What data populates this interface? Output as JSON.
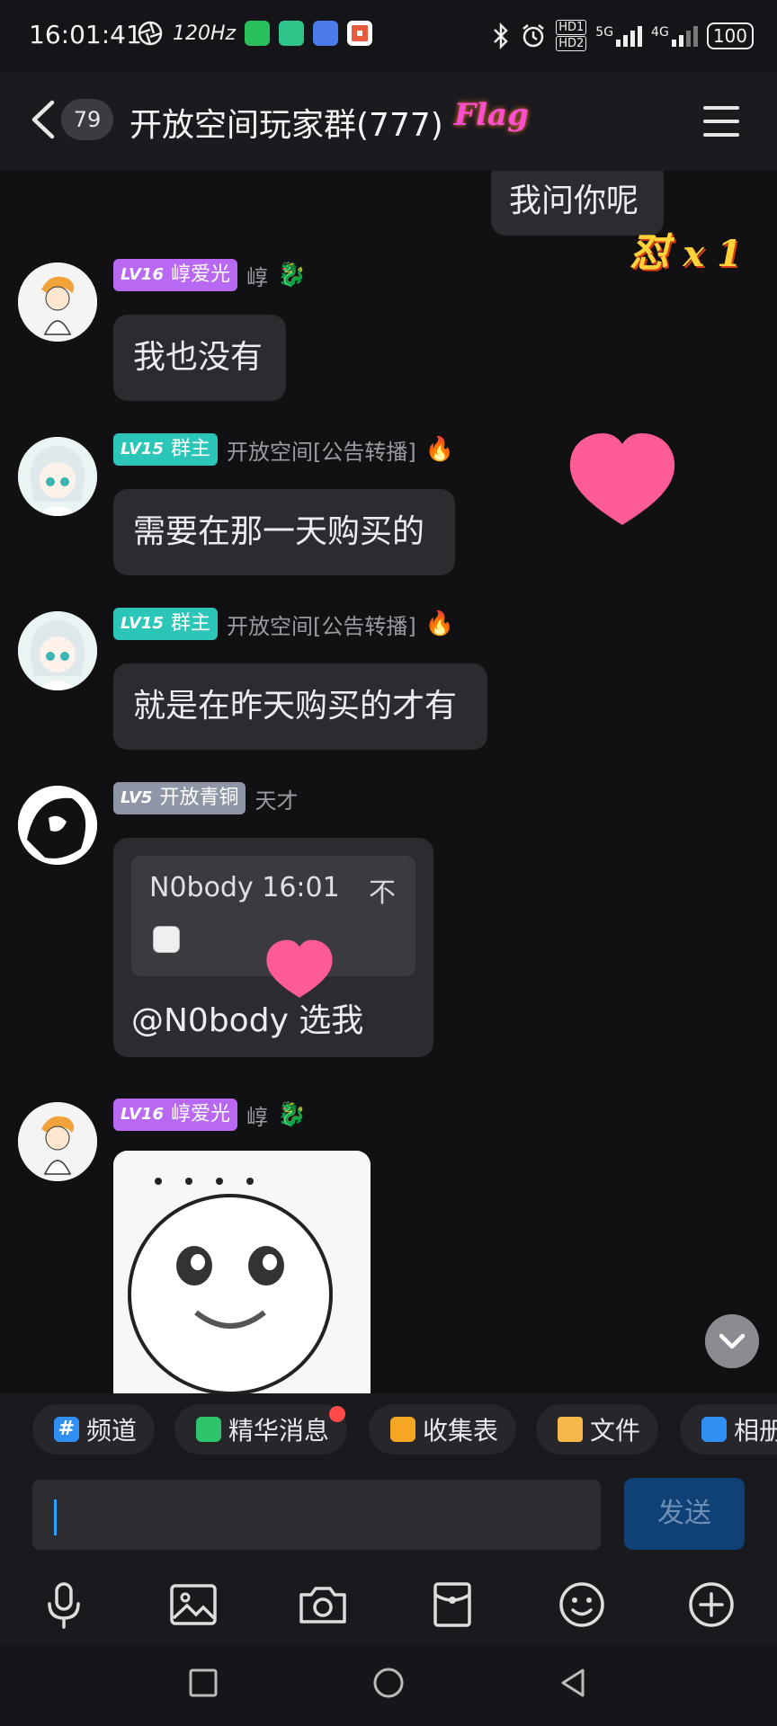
{
  "status_bar": {
    "time": "16:01:41",
    "refresh_rate": "120Hz",
    "sim1": "HD1",
    "sim2": "HD2",
    "net1": "5G",
    "net2": "4G",
    "battery": "100"
  },
  "header": {
    "unread_count": "79",
    "title": "开放空间玩家群(777)",
    "title_sticker": "Flag"
  },
  "messages": {
    "m0": {
      "text": "我问你呢",
      "reaction_char": "怼",
      "reaction_count": "x 1"
    },
    "m1": {
      "level": "LV16",
      "nick": "崞爱光",
      "sub": "崞",
      "text": "我也没有"
    },
    "m2": {
      "level": "LV15",
      "role": "群主",
      "sub": "开放空间[公告转播]",
      "text": "需要在那一天购买的"
    },
    "m3": {
      "level": "LV15",
      "role": "群主",
      "sub": "开放空间[公告转播]",
      "text": "就是在昨天购买的才有"
    },
    "m4": {
      "level": "LV5",
      "title": "开放青铜",
      "sub": "天才",
      "quote_name": "N0body 16:01",
      "quote_pin": "不",
      "text": "@N0body 选我"
    },
    "m5": {
      "level": "LV16",
      "nick": "崞爱光",
      "sub": "崞"
    }
  },
  "toolbar": {
    "channel": "频道",
    "essence": "精华消息",
    "form": "收集表",
    "file": "文件",
    "album": "相册"
  },
  "composer": {
    "send": "发送"
  },
  "colors": {
    "lv16": "#b868f2",
    "lv15": "#2bc6b7",
    "lv5": "#8f97a6",
    "send_bg": "#0f4176",
    "caret": "#29a3ff",
    "heart": "#ff4f8e"
  }
}
